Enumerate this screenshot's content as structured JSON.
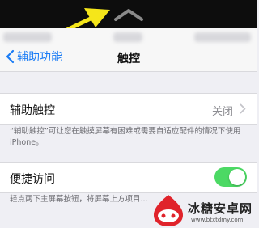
{
  "nav": {
    "back_label": "辅助功能",
    "title": "触控"
  },
  "assistive_touch": {
    "label": "辅助触控",
    "value": "关闭",
    "footnote": "“辅助触控”可让您在触摸屏幕有困难或需要自适应配件的情况下使用iPhone。"
  },
  "reachability": {
    "label": "便捷访问",
    "enabled": true,
    "footnote": "轻点两下主屏幕按钮，将屏幕上方项目..."
  },
  "watermark": {
    "name": "冰糖安卓网",
    "url": "www.btxtdmy.com"
  },
  "colors": {
    "accent": "#1a7cf5",
    "toggle_on": "#4cd964",
    "annotation_arrow": "#f5e61a"
  },
  "icons": [
    "home-indicator-chevron-icon",
    "annotation-arrow-icon",
    "back-chevron-icon",
    "disclosure-chevron-icon",
    "watermark-logo-icon"
  ]
}
